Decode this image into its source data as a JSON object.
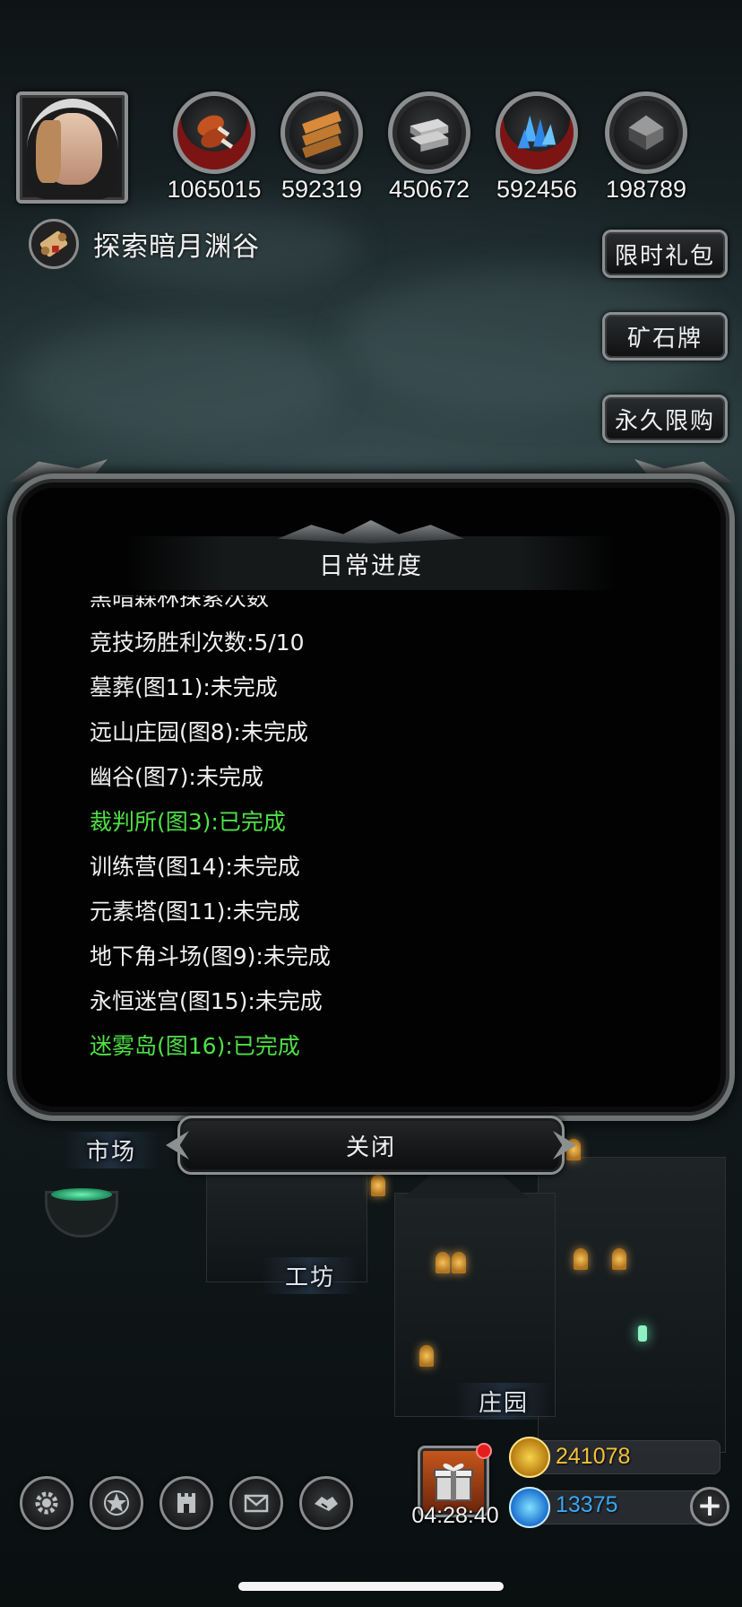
{
  "profile": {
    "avatar_icon": "hooded-heroine-portrait"
  },
  "resources": [
    {
      "icon": "meat-icon",
      "value": "1065015"
    },
    {
      "icon": "wood-planks-icon",
      "value": "592319"
    },
    {
      "icon": "iron-ingot-icon",
      "value": "450672"
    },
    {
      "icon": "blue-crystal-icon",
      "value": "592456"
    },
    {
      "icon": "dark-metal-icon",
      "value": "198789"
    }
  ],
  "quest": {
    "icon": "scroll-icon",
    "text": "探索暗月渊谷"
  },
  "side_buttons": {
    "limited_gift": "限时礼包",
    "ore_card": "矿石牌",
    "permanent_limited": "永久限购"
  },
  "places": {
    "market": "市场",
    "workshop": "工坊",
    "manor": "庄园"
  },
  "dialog": {
    "title": "日常进度",
    "items": [
      {
        "text": "黑暗森林探索次数",
        "done": false
      },
      {
        "text": "竞技场胜利次数:5/10",
        "done": false
      },
      {
        "text": "墓葬(图11):未完成",
        "done": false
      },
      {
        "text": "远山庄园(图8):未完成",
        "done": false
      },
      {
        "text": "幽谷(图7):未完成",
        "done": false
      },
      {
        "text": "裁判所(图3):已完成",
        "done": true
      },
      {
        "text": "训练营(图14):未完成",
        "done": false
      },
      {
        "text": "元素塔(图11):未完成",
        "done": false
      },
      {
        "text": "地下角斗场(图9):未完成",
        "done": false
      },
      {
        "text": "永恒迷宫(图15):未完成",
        "done": false
      },
      {
        "text": "迷雾岛(图16):已完成",
        "done": true
      }
    ],
    "close_label": "关闭",
    "done_color": "#4fe046"
  },
  "bottom": {
    "menu_icons": [
      "gear-icon",
      "star-icon",
      "castle-icon",
      "mail-icon",
      "handshake-icon"
    ],
    "gift_timer": "04:28:40",
    "gold": "241078",
    "gems": "13375",
    "plus_symbol": "+"
  }
}
